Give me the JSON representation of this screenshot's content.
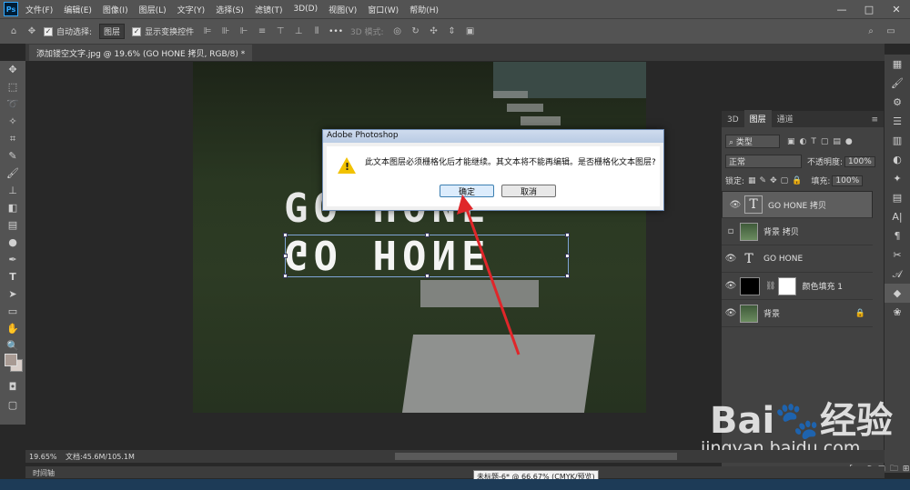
{
  "app": {
    "logo": "Ps"
  },
  "menu": [
    "文件(F)",
    "编辑(E)",
    "图像(I)",
    "图层(L)",
    "文字(Y)",
    "选择(S)",
    "滤镜(T)",
    "3D(D)",
    "视图(V)",
    "窗口(W)",
    "帮助(H)"
  ],
  "window_controls": {
    "minimize": "—",
    "maximize": "□",
    "close": "✕"
  },
  "options": {
    "auto_select_label": "自动选择:",
    "auto_select_value": "图层",
    "show_transform_label": "显示变换控件",
    "mode_3d_label": "3D 模式:",
    "more": "•••"
  },
  "document": {
    "tab_title": "添加镂空文字.jpg @ 19.6% (GO HONE 拷贝, RGB/8) *"
  },
  "canvas": {
    "text_top": "GO HONE",
    "text_bottom": "GO HONE"
  },
  "dialog": {
    "title": "Adobe Photoshop",
    "message": "此文本图层必须栅格化后才能继续。其文本将不能再编辑。是否栅格化文本图层?",
    "ok": "确定",
    "cancel": "取消",
    "warning_icon": "warning-icon"
  },
  "layers_panel": {
    "tabs": [
      "3D",
      "图层",
      "通道"
    ],
    "filter_label": "类型",
    "blend_mode": "正常",
    "opacity_label": "不透明度:",
    "opacity_value": "100%",
    "lock_label": "锁定:",
    "fill_label": "填充:",
    "fill_value": "100%",
    "layers": [
      {
        "name": "GO HONE 拷贝",
        "kind": "text",
        "visible": true,
        "selected": true
      },
      {
        "name": "背景 拷贝",
        "kind": "photo",
        "visible": false,
        "selected": false
      },
      {
        "name": "GO HONE",
        "kind": "text",
        "visible": true,
        "selected": false
      },
      {
        "name": "颜色填充 1",
        "kind": "fill",
        "visible": true,
        "selected": false
      },
      {
        "name": "背景",
        "kind": "photo",
        "visible": true,
        "selected": false,
        "locked": true
      }
    ]
  },
  "status": {
    "zoom": "19.65%",
    "doc_info": "文档:45.6M/105.1M"
  },
  "timeline": {
    "label": "时间轴"
  },
  "tooltip": "未标题-6* @ 66.67% (CMYK/预览)",
  "watermark": {
    "logo": "Bai🐾经验",
    "url": "jingyan.baidu.com"
  }
}
